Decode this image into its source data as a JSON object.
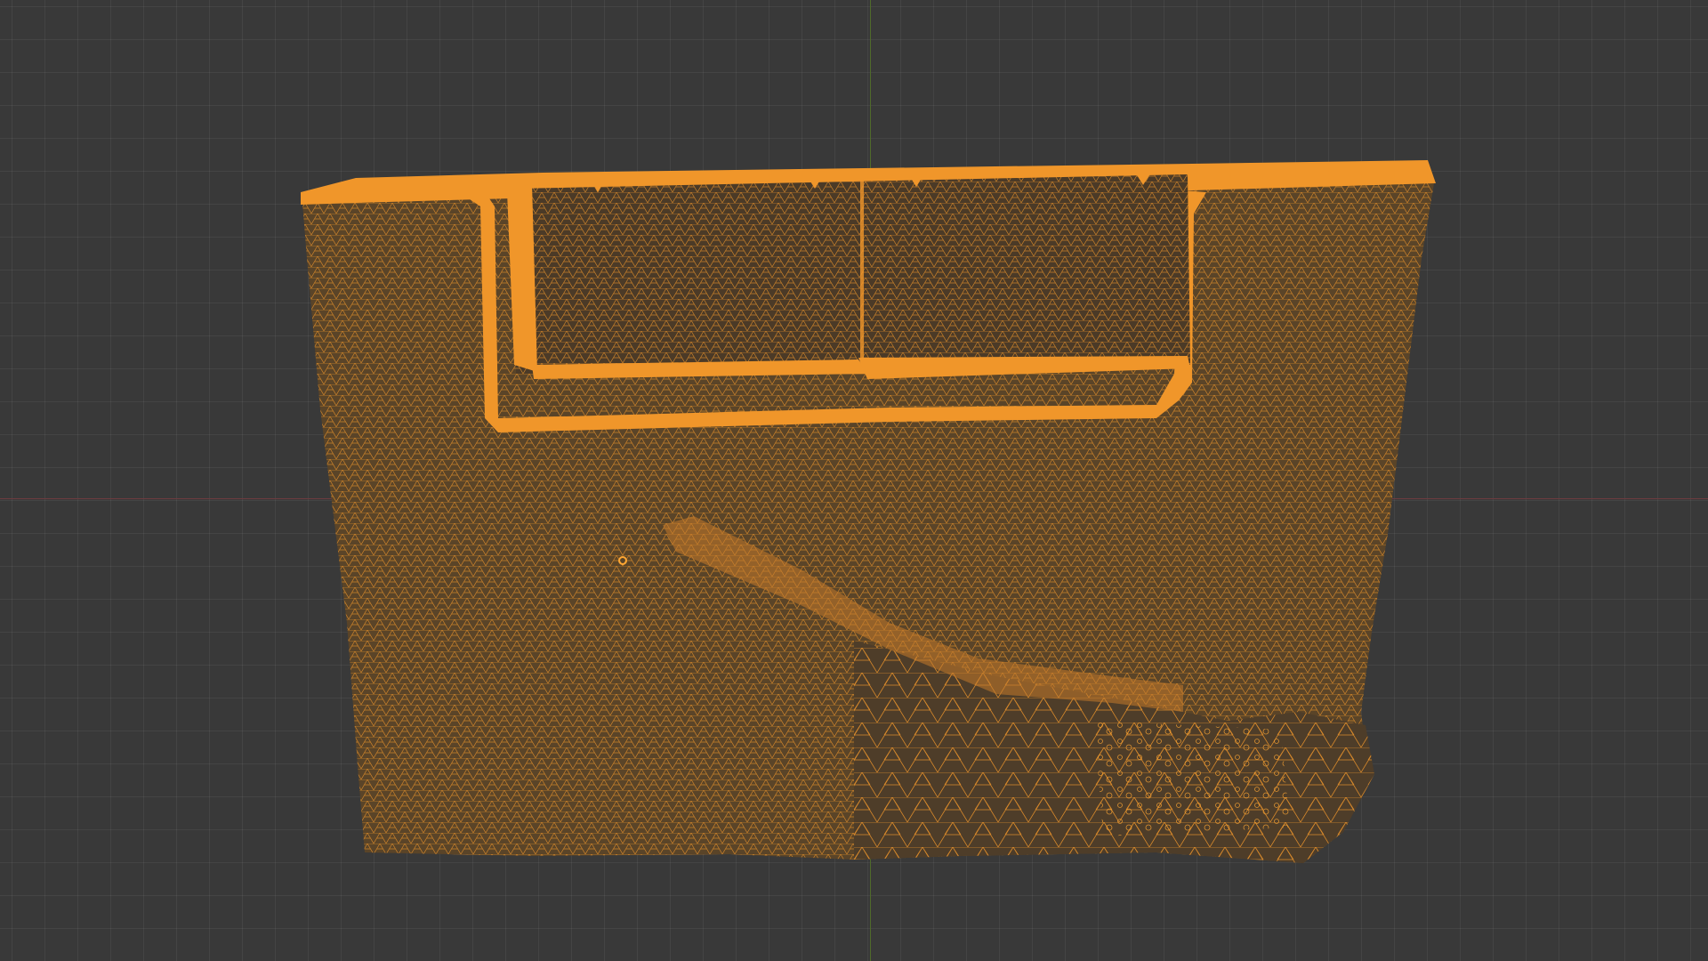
{
  "viewport": {
    "background_color": "#393939",
    "grid_color": "#454545",
    "axis_x_color": "#6f3b3f",
    "axis_y_color": "#4f6a2a"
  },
  "mesh": {
    "display_mode": "wireframe",
    "wire_color": "#f0962a",
    "fill_color": "#5a4428",
    "edge_highlight_color": "#ffa733"
  }
}
